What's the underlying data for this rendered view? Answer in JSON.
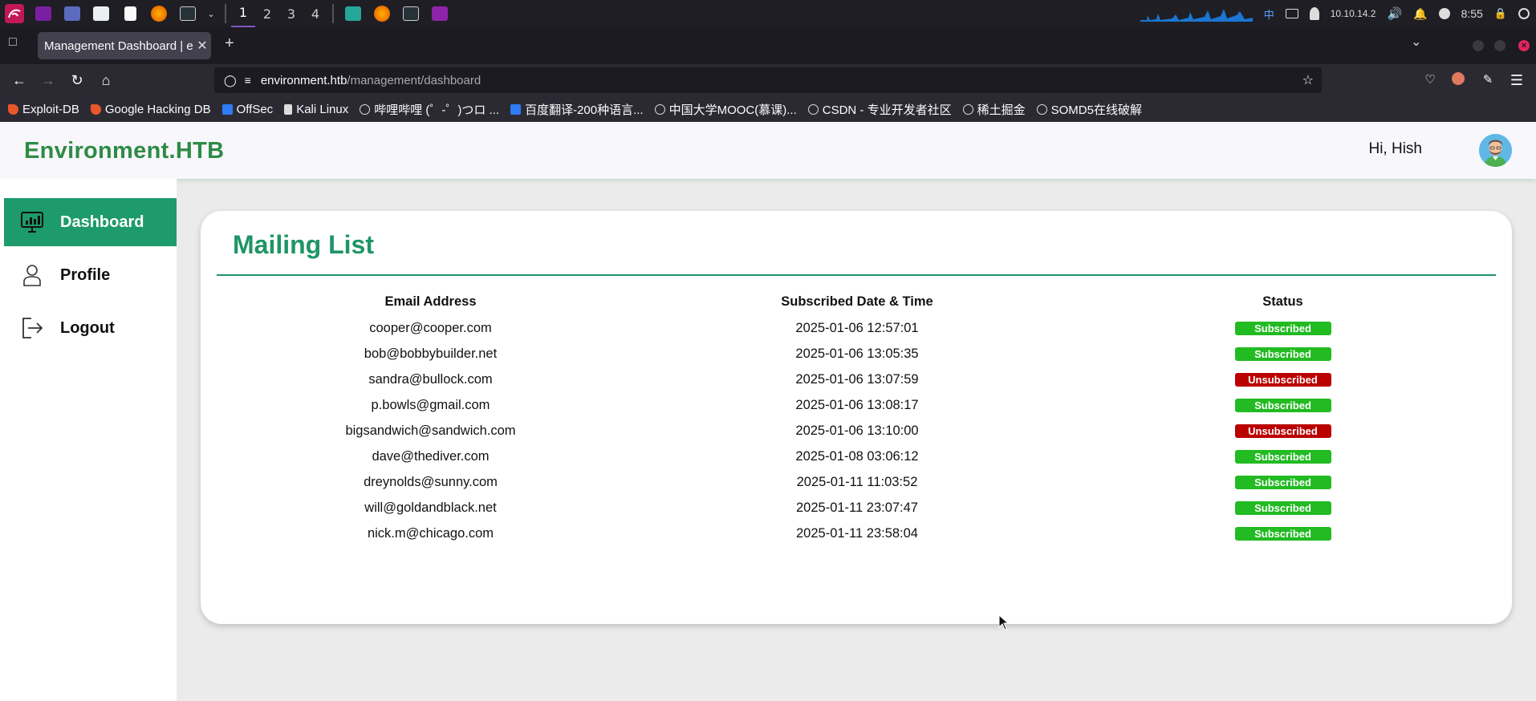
{
  "os": {
    "workspaces": [
      "1",
      "2",
      "3",
      "4"
    ],
    "active_workspace": "1",
    "tray": {
      "ime": "中",
      "ip": "10.10.14.2",
      "time": "8:55"
    }
  },
  "browser": {
    "tab_title": "Management Dashboard | en",
    "url_host": "environment.htb",
    "url_path": "/management/dashboard",
    "bookmarks": [
      {
        "label": "Exploit-DB",
        "icon": "fire"
      },
      {
        "label": "Google Hacking DB",
        "icon": "fire"
      },
      {
        "label": "OffSec",
        "icon": "blue"
      },
      {
        "label": "Kali Linux",
        "icon": "dragon"
      },
      {
        "label": "哔哩哔哩 (゜-゜)つロ ...",
        "icon": "globe"
      },
      {
        "label": "百度翻译-200种语言...",
        "icon": "blue"
      },
      {
        "label": "中国大学MOOC(慕课)...",
        "icon": "globe"
      },
      {
        "label": "CSDN - 专业开发者社区",
        "icon": "globe"
      },
      {
        "label": "稀土掘金",
        "icon": "globe"
      },
      {
        "label": "SOMD5在线破解",
        "icon": "globe"
      }
    ]
  },
  "header": {
    "brand": "Environment.HTB",
    "greeting": "Hi, Hish"
  },
  "sidebar": {
    "items": [
      {
        "label": "Dashboard",
        "icon": "monitor-chart-icon",
        "active": true
      },
      {
        "label": "Profile",
        "icon": "user-icon",
        "active": false
      },
      {
        "label": "Logout",
        "icon": "logout-icon",
        "active": false
      }
    ]
  },
  "main": {
    "title": "Mailing List",
    "columns": [
      "Email Address",
      "Subscribed Date & Time",
      "Status"
    ],
    "status_colors": {
      "Subscribed": "#22bb22",
      "Unsubscribed": "#bb0000"
    },
    "rows": [
      {
        "email": "cooper@cooper.com",
        "date": "2025-01-06 12:57:01",
        "status": "Subscribed"
      },
      {
        "email": "bob@bobbybuilder.net",
        "date": "2025-01-06 13:05:35",
        "status": "Subscribed"
      },
      {
        "email": "sandra@bullock.com",
        "date": "2025-01-06 13:07:59",
        "status": "Unsubscribed"
      },
      {
        "email": "p.bowls@gmail.com",
        "date": "2025-01-06 13:08:17",
        "status": "Subscribed"
      },
      {
        "email": "bigsandwich@sandwich.com",
        "date": "2025-01-06 13:10:00",
        "status": "Unsubscribed"
      },
      {
        "email": "dave@thediver.com",
        "date": "2025-01-08 03:06:12",
        "status": "Subscribed"
      },
      {
        "email": "dreynolds@sunny.com",
        "date": "2025-01-11 11:03:52",
        "status": "Subscribed"
      },
      {
        "email": "will@goldandblack.net",
        "date": "2025-01-11 23:07:47",
        "status": "Subscribed"
      },
      {
        "email": "nick.m@chicago.com",
        "date": "2025-01-11 23:58:04",
        "status": "Subscribed"
      }
    ]
  }
}
